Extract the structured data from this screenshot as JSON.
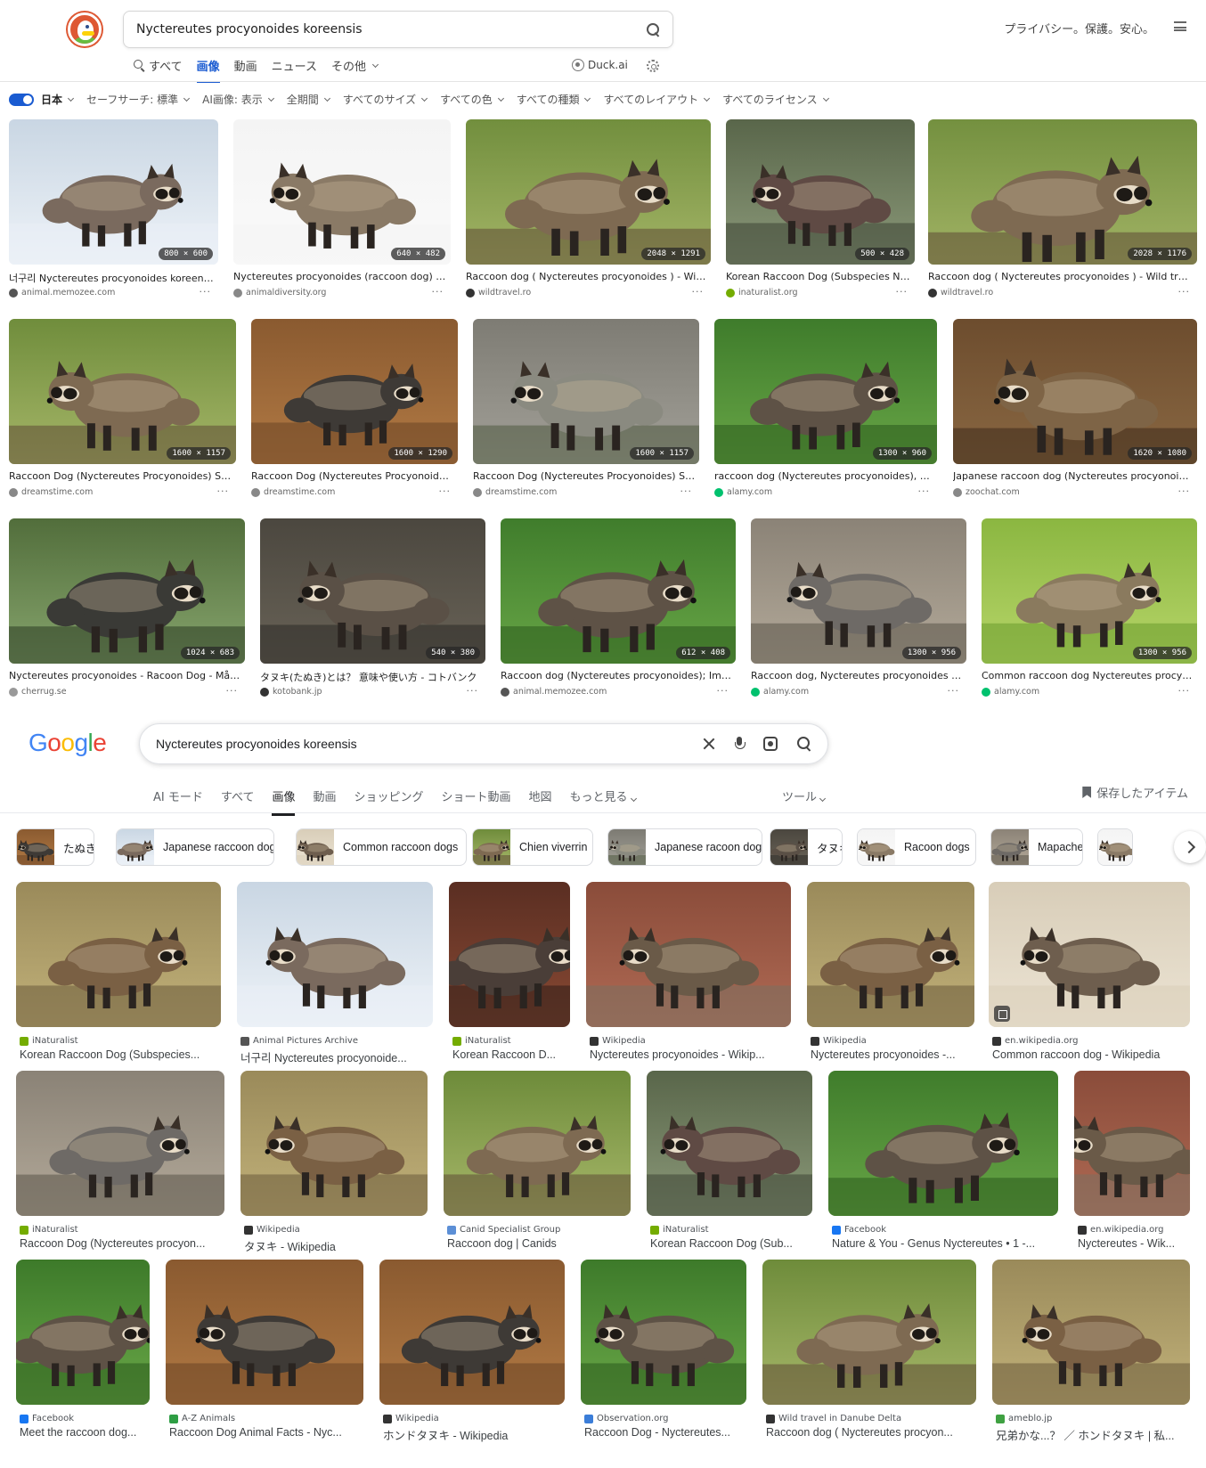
{
  "ddg": {
    "search_query": "Nyctereutes procyonoides koreensis",
    "header_right": "プライバシー。保護。安心。",
    "tabs": [
      {
        "label": "すべて",
        "icon": "search-icon",
        "active": false
      },
      {
        "label": "画像",
        "active": true
      },
      {
        "label": "動画",
        "active": false
      },
      {
        "label": "ニュース",
        "active": false
      },
      {
        "label": "その他",
        "active": false,
        "dropdown": true
      }
    ],
    "duck_ai_label": "Duck.ai",
    "filters": [
      {
        "label": "日本",
        "type": "region"
      },
      {
        "label": "セーフサーチ: 標準"
      },
      {
        "label": "AI画像: 表示"
      },
      {
        "label": "全期間"
      },
      {
        "label": "すべてのサイズ"
      },
      {
        "label": "すべての色"
      },
      {
        "label": "すべての種類"
      },
      {
        "label": "すべてのレイアウト"
      },
      {
        "label": "すべてのライセンス"
      }
    ],
    "results": [
      {
        "title": "너구리 Nyctereutes procyonoides koreensis",
        "source": "animal.memozee.com",
        "dims": "800 × 600",
        "scene": "snow",
        "fav": "#555"
      },
      {
        "title": "Nyctereutes procyonoides (raccoon dog) | I...",
        "source": "animaldiversity.org",
        "dims": "640 × 482",
        "scene": "white",
        "fav": "#888"
      },
      {
        "title": "Raccoon dog ( Nyctereutes procyonoides ) - Wild t...",
        "source": "wildtravel.ro",
        "dims": "2048 × 1291",
        "scene": "grass",
        "fav": "#333"
      },
      {
        "title": "Korean Raccoon Dog (Subspecies Ny...",
        "source": "inaturalist.org",
        "dims": "500 × 428",
        "scene": "dark-grass",
        "fav": "#74ac00"
      },
      {
        "title": "Raccoon dog ( Nyctereutes procyonoides ) - Wild trave...",
        "source": "wildtravel.ro",
        "dims": "2028 × 1176",
        "scene": "grass",
        "fav": "#333"
      },
      {
        "title": "Raccoon Dog (Nyctereutes Procyonoides) Sto...",
        "source": "dreamstime.com",
        "dims": "1600 × 1157",
        "scene": "grass",
        "fav": "#888"
      },
      {
        "title": "Raccoon Dog (Nyctereutes Procyonoides) ...",
        "source": "dreamstime.com",
        "dims": "1600 × 1290",
        "scene": "leaves",
        "fav": "#888"
      },
      {
        "title": "Raccoon Dog (Nyctereutes Procyonoides) Sto...",
        "source": "dreamstime.com",
        "dims": "1600 × 1157",
        "scene": "gray",
        "fav": "#888"
      },
      {
        "title": "raccoon dog (Nyctereutes procyonoides), wit...",
        "source": "alamy.com",
        "dims": "1300 × 960",
        "scene": "green",
        "fav": "#00c16e"
      },
      {
        "title": "Japanese raccoon dog (Nyctereutes procyonoides...",
        "source": "zoochat.com",
        "dims": "1620 × 1080",
        "scene": "brown",
        "fav": "#888"
      },
      {
        "title": "Nyctereutes procyonoides - Racoon Dog - Mårdh...",
        "source": "cherrug.se",
        "dims": "1024 × 683",
        "scene": "moss",
        "fav": "#999"
      },
      {
        "title": "タヌキ(たぬき)とは？ 意味や使い方 - コトバンク",
        "source": "kotobank.jp",
        "dims": "540 × 380",
        "scene": "dark",
        "fav": "#333"
      },
      {
        "title": "Raccoon dog (Nyctereutes procyonoides); Imag...",
        "source": "animal.memozee.com",
        "dims": "612 × 408",
        "scene": "green",
        "fav": "#555"
      },
      {
        "title": "Raccoon dog, Nyctereutes procyonoides St...",
        "source": "alamy.com",
        "dims": "1300 × 956",
        "scene": "rock",
        "fav": "#00c16e"
      },
      {
        "title": "Common raccoon dog Nyctereutes procyon...",
        "source": "alamy.com",
        "dims": "1300 × 956",
        "scene": "lime",
        "fav": "#00c16e"
      }
    ]
  },
  "google": {
    "search_query": "Nyctereutes procyonoides koreensis",
    "tabs": [
      {
        "label": "AI モード",
        "active": false
      },
      {
        "label": "すべて",
        "active": false
      },
      {
        "label": "画像",
        "active": true
      },
      {
        "label": "動画",
        "active": false
      },
      {
        "label": "ショッピング",
        "active": false
      },
      {
        "label": "ショート動画",
        "active": false
      },
      {
        "label": "地図",
        "active": false
      },
      {
        "label": "もっと見る",
        "active": false
      }
    ],
    "tools_label": "ツール",
    "saved_label": "保存したアイテム",
    "chips": [
      {
        "label": "たぬき"
      },
      {
        "label": "Japanese raccoon dog"
      },
      {
        "label": "Common raccoon dogs"
      },
      {
        "label": "Chien viverrin"
      },
      {
        "label": "Japanese racoon dog"
      },
      {
        "label": "タヌキ"
      },
      {
        "label": "Racoon dogs"
      },
      {
        "label": "Mapache"
      }
    ],
    "results": [
      {
        "source": "iNaturalist",
        "title": "Korean Raccoon Dog (Subspecies...",
        "scene": "dry-grass",
        "fav": "#74ac00"
      },
      {
        "source": "Animal Pictures Archive",
        "title": "너구리 Nyctereutes procyonoide...",
        "scene": "snow",
        "fav": "#555"
      },
      {
        "source": "iNaturalist",
        "title": "Korean Raccoon D...",
        "scene": "door",
        "fav": "#74ac00"
      },
      {
        "source": "Wikipedia",
        "title": "Nyctereutes procyonoides - Wikip...",
        "scene": "brick",
        "fav": "#333"
      },
      {
        "source": "Wikipedia",
        "title": "Nyctereutes procyonoides -...",
        "scene": "dry-grass",
        "fav": "#333"
      },
      {
        "source": "en.wikipedia.org",
        "title": "Common raccoon dog - Wikipedia",
        "scene": "beige",
        "fav": "#333"
      },
      {
        "source": "iNaturalist",
        "title": "Raccoon Dog (Nyctereutes procyon...",
        "scene": "rock",
        "fav": "#74ac00"
      },
      {
        "source": "Wikipedia",
        "title": "タヌキ - Wikipedia",
        "scene": "dry-grass",
        "fav": "#333"
      },
      {
        "source": "Canid Specialist Group",
        "title": "Raccoon dog | Canids",
        "scene": "grass",
        "fav": "#5c8fd6"
      },
      {
        "source": "iNaturalist",
        "title": "Korean Raccoon Dog (Sub...",
        "scene": "dark-grass",
        "fav": "#74ac00"
      },
      {
        "source": "Facebook",
        "title": "Nature & You - Genus Nyctereutes • 1 -...",
        "scene": "green",
        "fav": "#1877f2"
      },
      {
        "source": "en.wikipedia.org",
        "title": "Nyctereutes - Wik...",
        "scene": "brick",
        "fav": "#333"
      },
      {
        "source": "Facebook",
        "title": "Meet the raccoon dog...",
        "scene": "green",
        "fav": "#1877f2"
      },
      {
        "source": "A-Z Animals",
        "title": "Raccoon Dog Animal Facts - Nyc...",
        "scene": "leaves",
        "fav": "#2e9e44"
      },
      {
        "source": "Wikipedia",
        "title": "ホンドタヌキ - Wikipedia",
        "scene": "leaves",
        "fav": "#333"
      },
      {
        "source": "Observation.org",
        "title": "Raccoon Dog - Nyctereutes...",
        "scene": "green",
        "fav": "#3b7dd8"
      },
      {
        "source": "Wild travel in Danube Delta",
        "title": "Raccoon dog ( Nyctereutes procyon...",
        "scene": "grass",
        "fav": "#333"
      },
      {
        "source": "ameblo.jp",
        "title": "兄弟かな...？ ／ ホンドタヌキ | 私...",
        "scene": "dry-grass",
        "fav": "#3fa142"
      }
    ]
  }
}
